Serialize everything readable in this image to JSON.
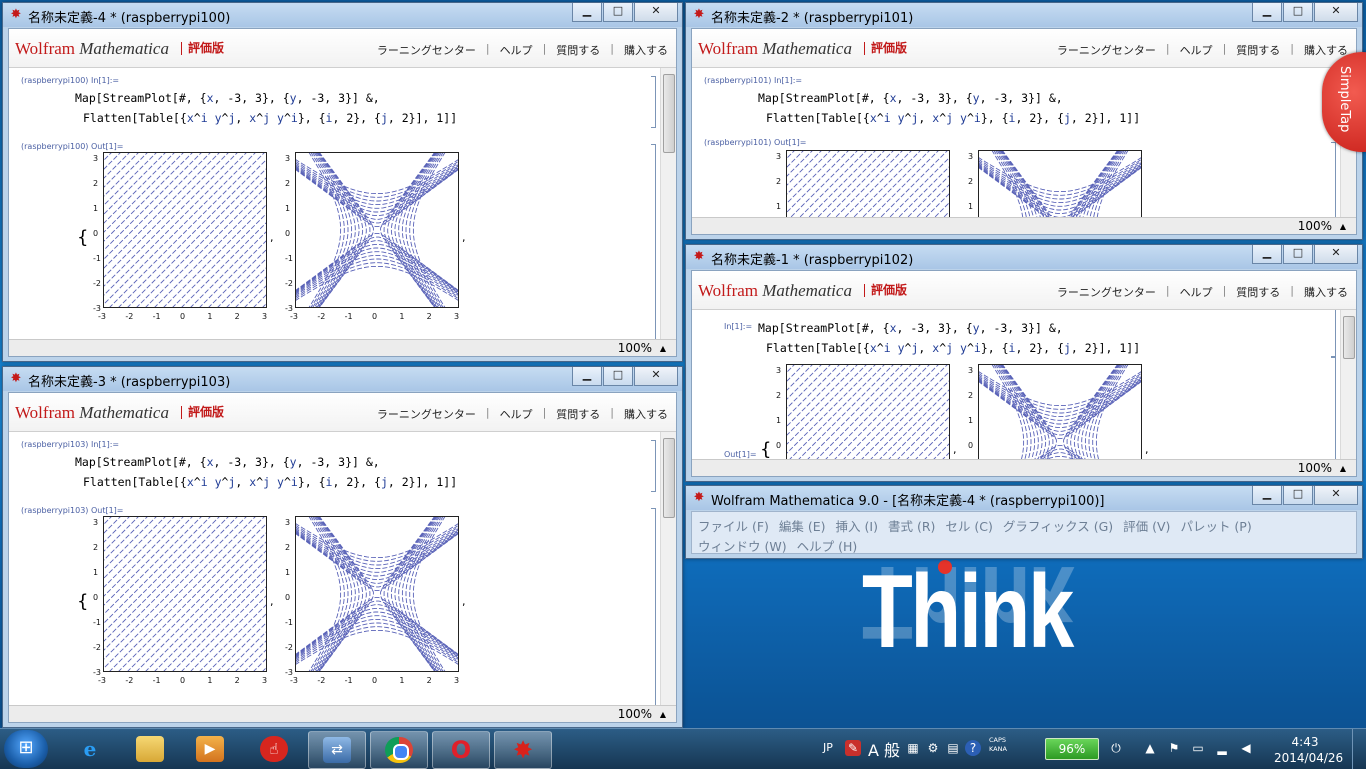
{
  "desktop": {
    "wallpaper_text": "Think"
  },
  "brand": {
    "wolfram": "Wolfram",
    "mathematica": "Mathematica",
    "trial": "評価版"
  },
  "links": [
    "ラーニングセンター",
    "ヘルプ",
    "質問する",
    "購入する"
  ],
  "window_controls": {
    "minimize": "▁",
    "maximize": "□",
    "close": "✕"
  },
  "windows": [
    {
      "id": "w4",
      "title": "名称未定義-4 * (raspberrypi100)",
      "in_label": "(raspberrypi100) In[1]:=",
      "out_label": "(raspberrypi100) Out[1]=",
      "zoom": "100%"
    },
    {
      "id": "w2",
      "title": "名称未定義-2 * (raspberrypi101)",
      "in_label": "(raspberrypi101) In[1]:=",
      "out_label": "(raspberrypi101) Out[1]=",
      "zoom": "100%"
    },
    {
      "id": "w1",
      "title": "名称未定義-1 * (raspberrypi102)",
      "in_label": "In[1]:=",
      "out_label": "Out[1]=",
      "zoom": "100%"
    },
    {
      "id": "w3",
      "title": "名称未定義-3 * (raspberrypi103)",
      "in_label": "(raspberrypi103) In[1]:=",
      "out_label": "(raspberrypi103) Out[1]=",
      "zoom": "100%"
    }
  ],
  "code": {
    "line1": "Map[StreamPlot[#, {x, -3, 3}, {y, -3, 3}] &,",
    "line2": "Flatten[Table[{x^i y^j, x^j y^i}, {i, 2}, {j, 2}], 1]]"
  },
  "plot_ticks": [
    "-3",
    "-2",
    "-1",
    "0",
    "1",
    "2",
    "3"
  ],
  "main_window": {
    "title": "Wolfram Mathematica 9.0 - [名称未定義-4 * (raspberrypi100)]",
    "menu_row1": [
      "ファイル (F)",
      "編集 (E)",
      "挿入 (I)",
      "書式 (R)",
      "セル (C)",
      "グラフィックス (G)",
      "評価 (V)",
      "パレット (P)"
    ],
    "menu_row2": [
      "ウィンドウ (W)",
      "ヘルプ (H)"
    ]
  },
  "simpletap": "SimpleTap",
  "taskbar": {
    "start_glyph": "⊞",
    "language": "JP",
    "ime": "A 般",
    "caps": "CAPS",
    "kana": "KANA",
    "battery": "96%",
    "time": "4:43",
    "date": "2014/04/26"
  }
}
